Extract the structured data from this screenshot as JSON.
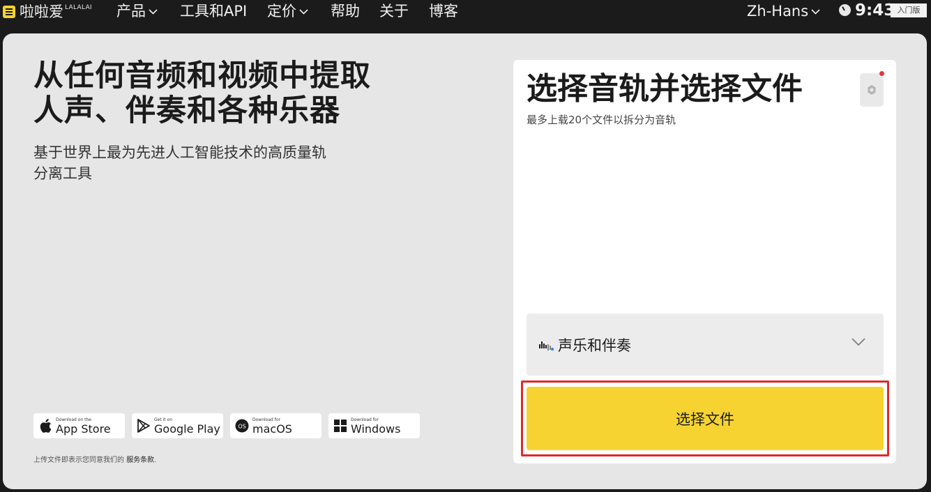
{
  "brand": {
    "name": "啦啦爱",
    "sup": "LALALAI",
    "accent": "#f6d330"
  },
  "nav": {
    "items": [
      {
        "label": "产品",
        "has_dropdown": true
      },
      {
        "label": "工具和API",
        "has_dropdown": false
      },
      {
        "label": "定价",
        "has_dropdown": true
      },
      {
        "label": "帮助",
        "has_dropdown": false
      },
      {
        "label": "关于",
        "has_dropdown": false
      },
      {
        "label": "博客",
        "has_dropdown": false
      }
    ],
    "language": "Zh-Hans",
    "time": "9:43",
    "badge": "入门版"
  },
  "hero": {
    "title_line1": "从任何音频和视频中提取",
    "title_line2": "人声、伴奏和各种乐器",
    "subtitle_line1": "基于世界上最为先进人工智能技术的高质量轨",
    "subtitle_line2": "分离工具"
  },
  "stores": [
    {
      "small": "Download on the",
      "big": "App Store",
      "icon": "apple-icon"
    },
    {
      "small": "Get it on",
      "big": "Google Play",
      "icon": "google-play-icon"
    },
    {
      "small": "Download for",
      "big": "macOS",
      "icon": "macos-icon"
    },
    {
      "small": "Download for",
      "big": "Windows",
      "icon": "windows-icon"
    }
  ],
  "terms": {
    "prefix": "上传文件即表示您同意我们的 ",
    "link": "服务条款",
    "suffix": "."
  },
  "panel": {
    "title": "选择音轨并选择文件",
    "subtitle": "最多上载20个文件以拆分为音轨",
    "stem_select": "声乐和伴奏",
    "cta": "选择文件",
    "notification_color": "#e8343a",
    "highlight_color": "#e0292b"
  }
}
